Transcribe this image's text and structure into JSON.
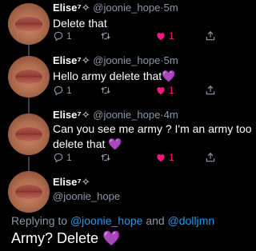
{
  "tweets": [
    {
      "name": "Elise⁷✧",
      "handle": "@joonie_hope",
      "time": "5m",
      "text": "Delete that",
      "heart": "",
      "reply_count": "1",
      "retweet_count": "",
      "like_count": "1"
    },
    {
      "name": "Elise⁷✧",
      "handle": "@joonie_hope",
      "time": "5m",
      "text": "Hello army delete that",
      "heart": "💜",
      "reply_count": "1",
      "retweet_count": "",
      "like_count": "1"
    },
    {
      "name": "Elise⁷✧",
      "handle": "@joonie_hope",
      "time": "4m",
      "text_line1": "Can you see me army ? I'm an army too",
      "text_line2": "delete that",
      "heart": "💜",
      "reply_count": "1",
      "retweet_count": "",
      "like_count": "1"
    }
  ],
  "main": {
    "name": "Elise⁷✧",
    "handle": "@joonie_hope",
    "replying_prefix": "Replying to",
    "mention1": "@joonie_hope",
    "and": "and",
    "mention2": "@dolljmn",
    "text": "Army? Delete",
    "heart": "💜"
  },
  "icons": [
    "reply-icon",
    "retweet-icon",
    "like-icon",
    "share-icon"
  ],
  "colors": {
    "background": "#000000",
    "like": "#f91880",
    "mention": "#1d9bf0",
    "muted": "#8b98a5"
  }
}
